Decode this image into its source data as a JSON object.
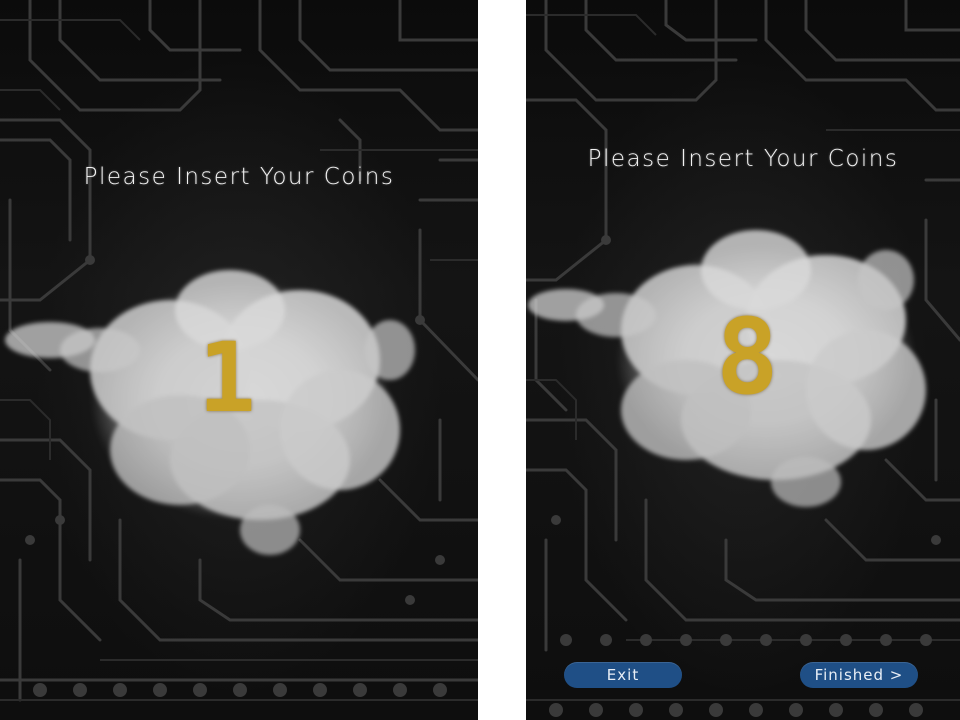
{
  "screens": [
    {
      "title": "Please Insert Your Coins",
      "coin_count": "1"
    },
    {
      "title": "Please Insert Your Coins",
      "coin_count": "8",
      "buttons": {
        "exit_label": "Exit",
        "finished_label": "Finished >"
      }
    }
  ],
  "colors": {
    "background": "#0e0e0e",
    "title_text": "#f2f2f2",
    "counter_gold": "#c9a227",
    "button_blue": "#1f4f86",
    "smoke_white": "#d9d9d9"
  },
  "icons": [
    "circuit-board-pattern",
    "smoke-cloud"
  ]
}
